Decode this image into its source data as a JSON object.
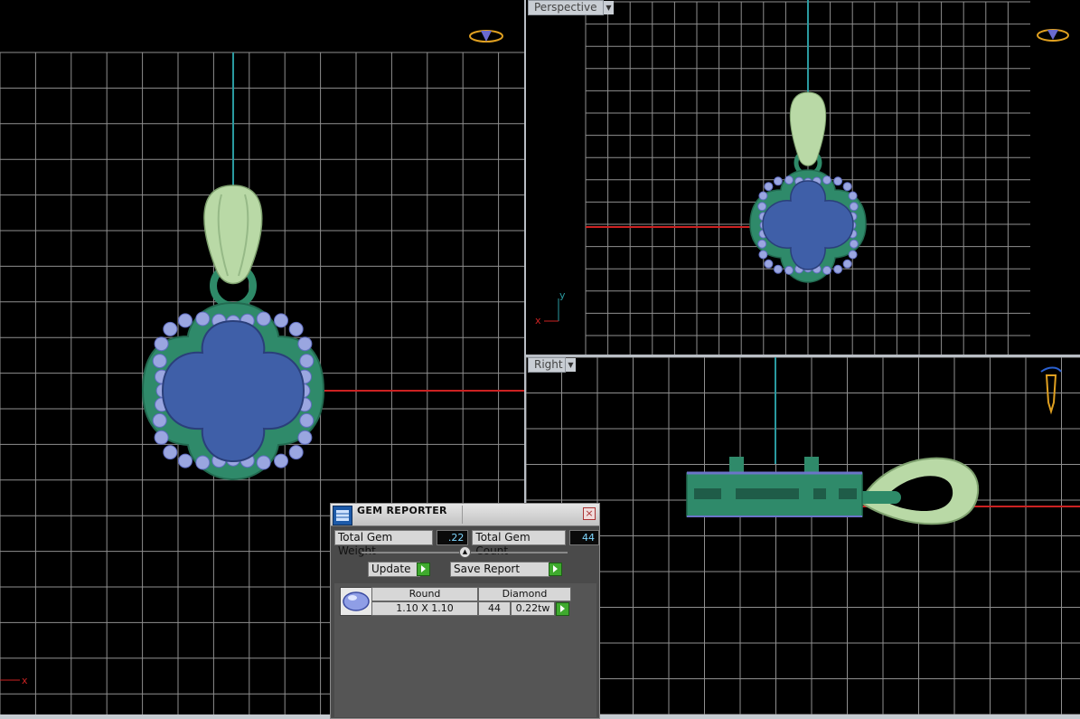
{
  "viewports": {
    "front": {
      "axis_label": "x"
    },
    "perspective": {
      "label": "Perspective",
      "axis_x": "x",
      "axis_y": "y"
    },
    "right": {
      "label": "Right"
    }
  },
  "colors": {
    "grid": "#8f8f8f",
    "metal": "#3a9a78",
    "bail": "#b9d9a6",
    "center_stone": "#3f5fa8",
    "side_stones": "#9aa6e0",
    "x_axis": "#cc2222",
    "z_axis": "#2a9aa0"
  },
  "gem_reporter": {
    "title": "GEM REPORTER",
    "close": "×",
    "total_weight_label": "Total Gem Weight",
    "total_weight_value": ".22",
    "total_count_label": "Total Gem Count",
    "total_count_value": "44",
    "update_label": "Update",
    "save_report_label": "Save Report",
    "rows": [
      {
        "shape": "Round",
        "type": "Diamond",
        "size": "1.10 X 1.10",
        "count": "44",
        "weight": "0.22tw"
      }
    ]
  }
}
